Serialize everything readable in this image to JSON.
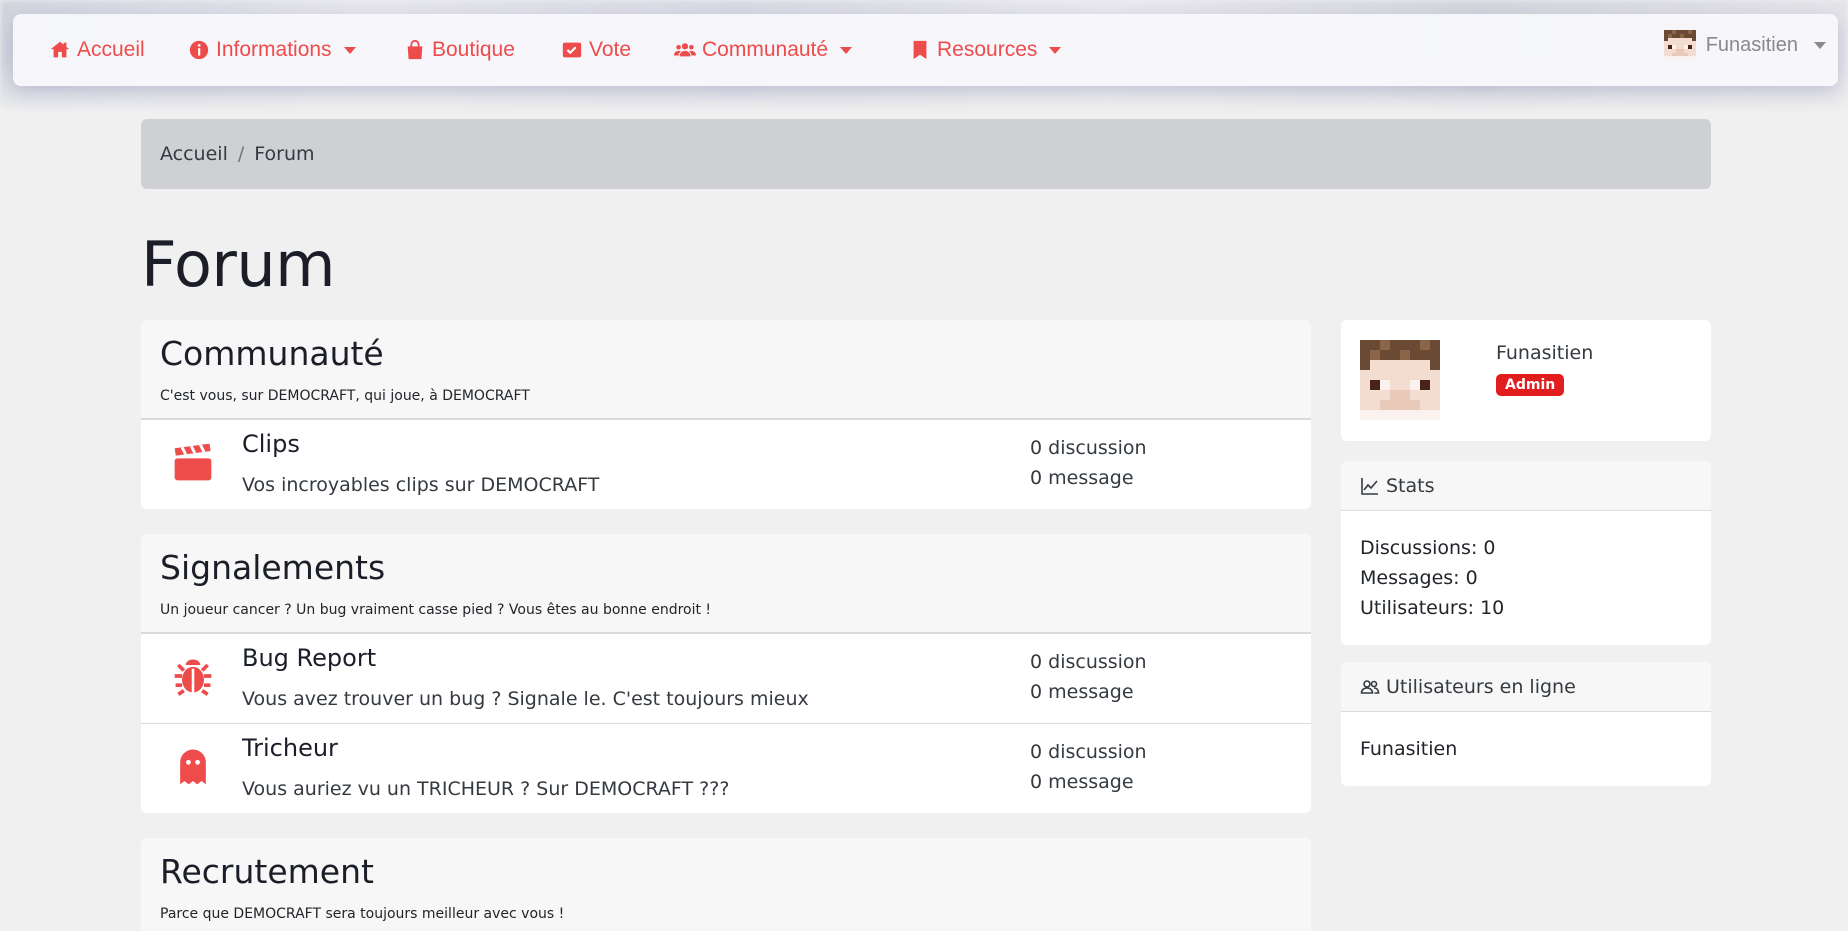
{
  "colors": {
    "accent": "#ee4b4b",
    "badge": "#e11d1d"
  },
  "nav": {
    "items": [
      {
        "label": "Accueil",
        "icon": "home-icon",
        "dropdown": false
      },
      {
        "label": "Informations",
        "icon": "info-icon",
        "dropdown": true
      },
      {
        "label": "Boutique",
        "icon": "shopping-bag-icon",
        "dropdown": false
      },
      {
        "label": "Vote",
        "icon": "vote-icon",
        "dropdown": false
      },
      {
        "label": "Communauté",
        "icon": "users-icon",
        "dropdown": true
      },
      {
        "label": "Resources",
        "icon": "bookmark-icon",
        "dropdown": true
      }
    ],
    "user": {
      "name": "Funasitien",
      "icon": "user-avatar"
    }
  },
  "breadcrumb": {
    "home": "Accueil",
    "separator": "/",
    "current": "Forum"
  },
  "page": {
    "title": "Forum"
  },
  "categories": [
    {
      "title": "Communauté",
      "description": "C'est vous, sur DEMOCRAFT, qui joue, à DEMOCRAFT",
      "forums": [
        {
          "icon": "clapperboard-icon",
          "name": "Clips",
          "description": "Vos incroyables clips sur DEMOCRAFT",
          "discussions": "0 discussion",
          "messages": "0 message"
        }
      ]
    },
    {
      "title": "Signalements",
      "description": "Un joueur cancer ? Un bug vraiment casse pied ? Vous êtes au bonne endroit !",
      "forums": [
        {
          "icon": "bug-icon",
          "name": "Bug Report",
          "description": "Vous avez trouver un bug ? Signale le. C'est toujours mieux",
          "discussions": "0 discussion",
          "messages": "0 message"
        },
        {
          "icon": "ghost-icon",
          "name": "Tricheur",
          "description": "Vous auriez vu un TRICHEUR ? Sur DEMOCRAFT ???",
          "discussions": "0 discussion",
          "messages": "0 message"
        }
      ]
    },
    {
      "title": "Recrutement",
      "description": "Parce que DEMOCRAFT sera toujours meilleur avec vous !",
      "forums": []
    }
  ],
  "sidebar": {
    "profile": {
      "name": "Funasitien",
      "role": "Admin"
    },
    "stats": {
      "title": "Stats",
      "icon": "chart-line-icon",
      "lines": [
        "Discussions: 0",
        "Messages: 0",
        "Utilisateurs: 10"
      ]
    },
    "online": {
      "title": "Utilisateurs en ligne",
      "icon": "users-outline-icon",
      "users": [
        "Funasitien"
      ]
    }
  }
}
